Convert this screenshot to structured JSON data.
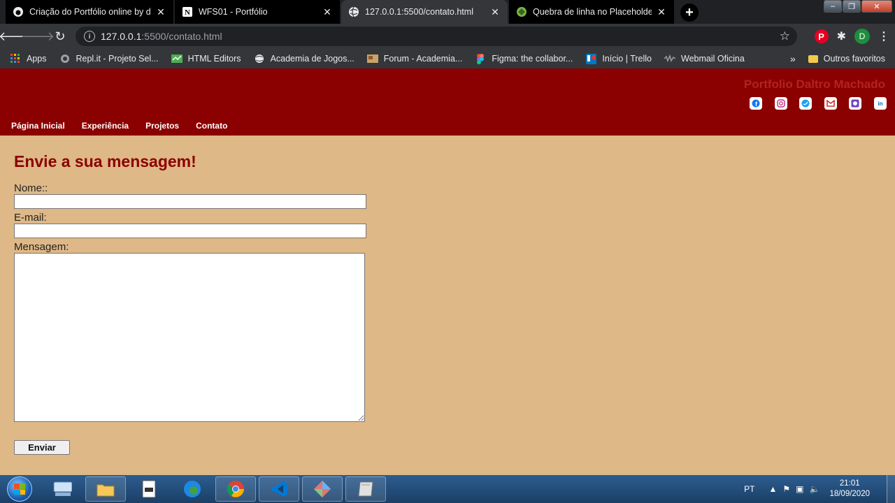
{
  "browser": {
    "tabs": [
      {
        "title": "Criação do Portfólio online by da",
        "icon": "github-icon"
      },
      {
        "title": "WFS01 - Portfólio",
        "icon": "notion-icon"
      },
      {
        "title": "127.0.0.1:5500/contato.html",
        "icon": "globe-icon",
        "active": true
      },
      {
        "title": "Quebra de linha no Placeholder -",
        "icon": "codepen-icon"
      }
    ],
    "url_host": "127.0.0.1",
    "url_path": ":5500/contato.html",
    "profile_initial": "D",
    "bookmarks": [
      {
        "label": "Apps",
        "icon": "apps-grid-icon"
      },
      {
        "label": "Repl.it - Projeto Sel...",
        "icon": "replit-icon"
      },
      {
        "label": "HTML Editors",
        "icon": "html-editors-icon"
      },
      {
        "label": "Academia de Jogos...",
        "icon": "globe-icon"
      },
      {
        "label": "Forum - Academia...",
        "icon": "forum-icon"
      },
      {
        "label": "Figma: the collabor...",
        "icon": "figma-icon"
      },
      {
        "label": "Início | Trello",
        "icon": "trello-icon"
      },
      {
        "label": "Webmail Oficina",
        "icon": "webmail-icon"
      }
    ],
    "other_bookmarks": "Outros favoritos"
  },
  "site": {
    "brand": "Portfolio Daltro Machado",
    "social": [
      "facebook-icon",
      "instagram-icon",
      "twitter-icon",
      "gmail-icon",
      "github-icon",
      "linkedin-icon"
    ],
    "nav": [
      "Página Inicial",
      "Experiência",
      "Projetos",
      "Contato"
    ]
  },
  "form": {
    "heading": "Envie a sua mensagem!",
    "name_label": "Nome::",
    "email_label": "E-mail:",
    "message_label": "Mensagem:",
    "submit_label": "Enviar"
  },
  "taskbar": {
    "language": "PT",
    "time": "21:01",
    "date": "18/09/2020"
  }
}
